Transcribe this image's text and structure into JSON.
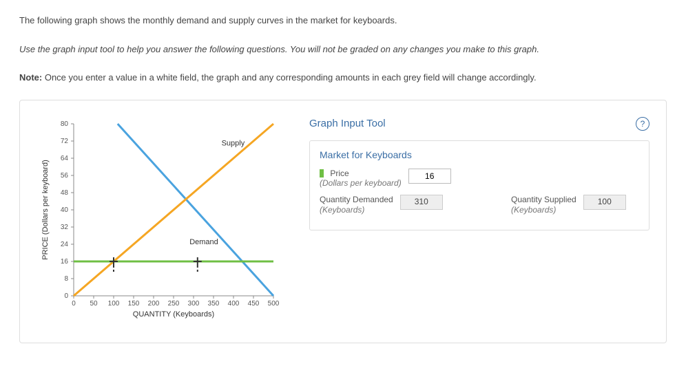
{
  "intro": {
    "line1": "The following graph shows the monthly demand and supply curves in the market for keyboards.",
    "line2": "Use the graph input tool to help you answer the following questions. You will not be graded on any changes you make to this graph.",
    "note_label": "Note:",
    "note_rest": " Once you enter a value in a white field, the graph and any corresponding amounts in each grey field will change accordingly."
  },
  "tool": {
    "title": "Graph Input Tool",
    "help": "?",
    "subtitle": "Market for Keyboards",
    "price_label": "Price",
    "price_sub": "(Dollars per keyboard)",
    "price_value": "16",
    "qd_label": "Quantity Demanded",
    "qd_sub": "(Keyboards)",
    "qd_value": "310",
    "qs_label": "Quantity Supplied",
    "qs_sub": "(Keyboards)",
    "qs_value": "100"
  },
  "chart_data": {
    "type": "line",
    "title": "",
    "xlabel": "QUANTITY (Keyboards)",
    "ylabel": "PRICE (Dollars per keyboard)",
    "xlim": [
      0,
      500
    ],
    "ylim": [
      0,
      80
    ],
    "x_ticks": [
      0,
      50,
      100,
      150,
      200,
      250,
      300,
      350,
      400,
      450,
      500
    ],
    "y_ticks": [
      0,
      8,
      16,
      24,
      32,
      40,
      48,
      56,
      64,
      72,
      80
    ],
    "series": [
      {
        "name": "Demand",
        "color": "#4aa3df",
        "points": [
          [
            110,
            80
          ],
          [
            500,
            0
          ]
        ]
      },
      {
        "name": "Supply",
        "color": "#f5a623",
        "points": [
          [
            0,
            0
          ],
          [
            500,
            80
          ]
        ]
      },
      {
        "name": "PriceLine",
        "color": "#6fbf44",
        "points": [
          [
            0,
            16
          ],
          [
            500,
            16
          ]
        ]
      }
    ],
    "markers": [
      {
        "x": 100,
        "y": 16,
        "color": "#333"
      },
      {
        "x": 310,
        "y": 16,
        "color": "#333"
      }
    ],
    "annotations": [
      {
        "text": "Supply",
        "x": 370,
        "y": 70
      },
      {
        "text": "Demand",
        "x": 290,
        "y": 24
      }
    ]
  }
}
